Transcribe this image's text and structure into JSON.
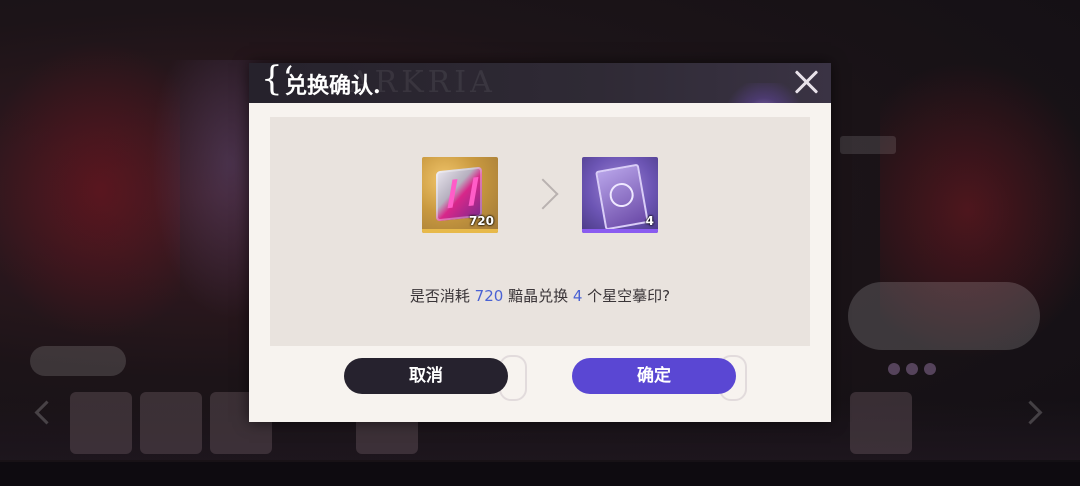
{
  "dialog": {
    "title": "换确认.",
    "title_prefix": "兑",
    "header_watermark": "ARKRIA",
    "close_icon": "close-icon"
  },
  "exchange": {
    "source_item": {
      "icon": "crystal-cube-icon",
      "count": "720"
    },
    "target_item": {
      "icon": "star-seal-card-icon",
      "count": "4"
    },
    "arrow_icon": "chevron-right-icon"
  },
  "message": {
    "prefix": "是否消耗 ",
    "source_amount": "720",
    "middle": " 黯晶兑换 ",
    "target_amount": "4",
    "suffix": " 个星空摹印?"
  },
  "buttons": {
    "cancel_label": "取消",
    "confirm_label": "确定"
  },
  "colors": {
    "header_bg": "#2f2a35",
    "dialog_bg": "#f7f3ef",
    "panel_bg": "#e9e3de",
    "number_accent": "#4a62d4",
    "cancel_bg": "#26222e",
    "confirm_bg": "#5a47d3"
  }
}
